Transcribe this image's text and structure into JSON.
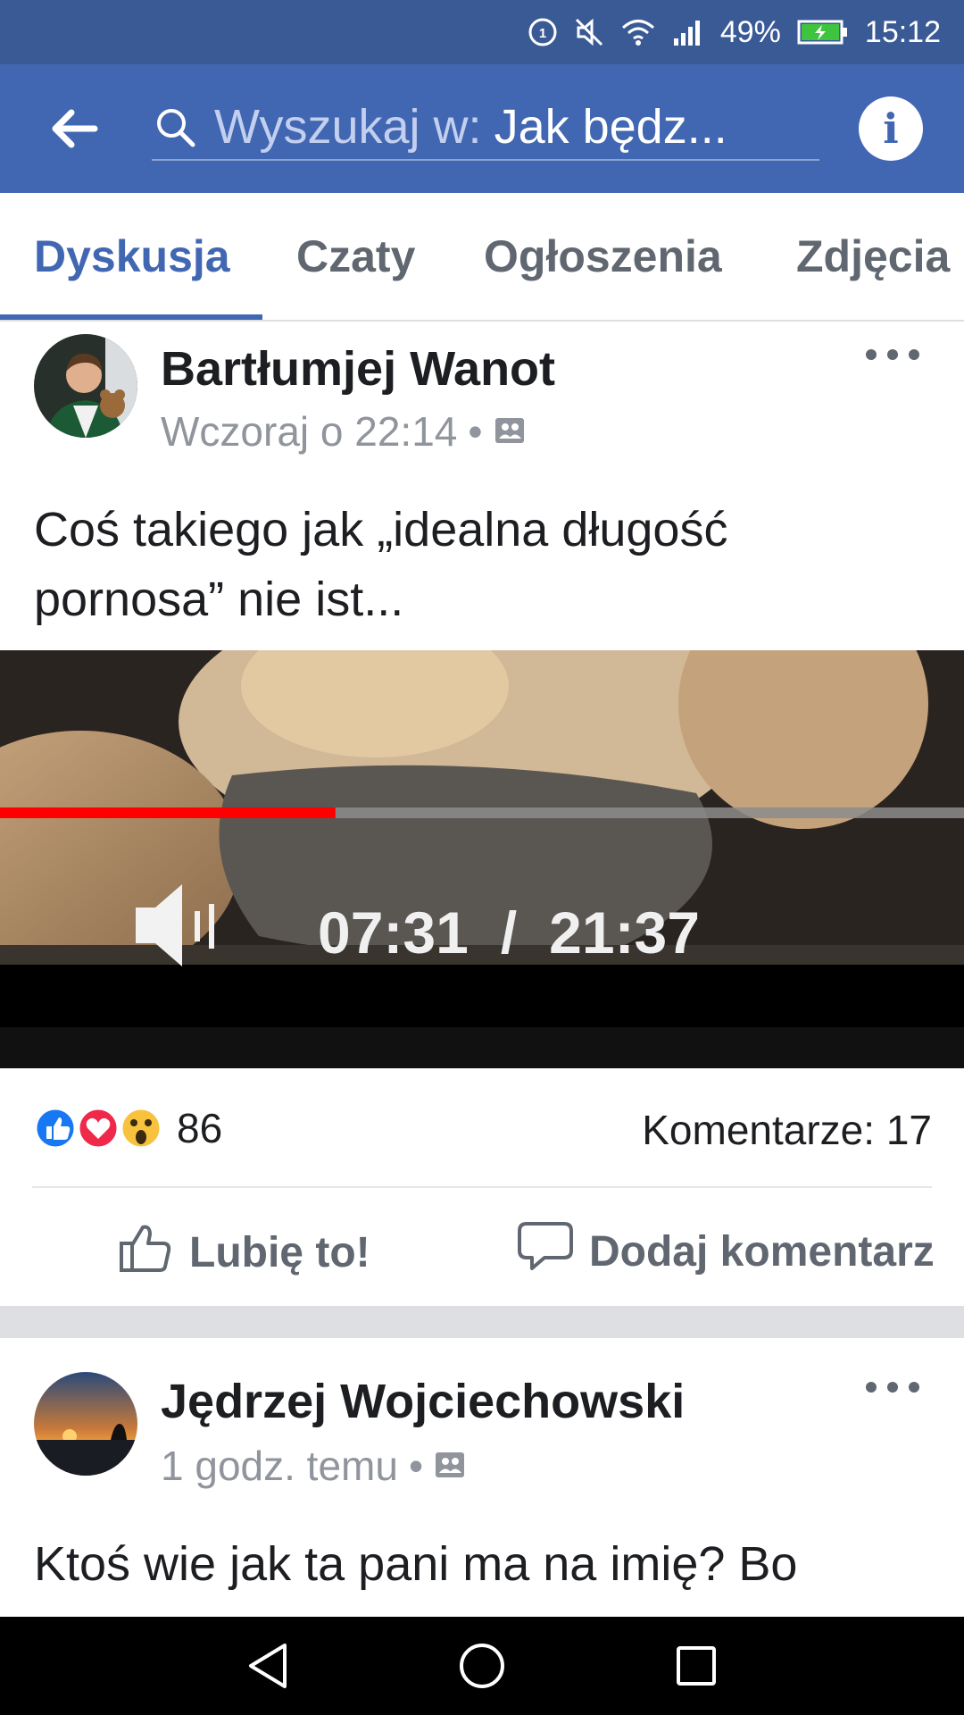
{
  "status_bar": {
    "battery_percent": "49%",
    "time": "15:12",
    "icons": [
      "data-sync-icon",
      "mute-icon",
      "wifi-icon",
      "signal-icon",
      "battery-charging-icon"
    ]
  },
  "app_bar": {
    "back_icon": "back-arrow-icon",
    "search_placeholder": "Wyszukaj w:",
    "search_scope": "Jak będz...",
    "info_icon": "info-icon",
    "info_label": "i"
  },
  "tabs": [
    {
      "label": "Dyskusja",
      "active": true
    },
    {
      "label": "Czaty",
      "active": false
    },
    {
      "label": "Ogłoszenia",
      "active": false
    },
    {
      "label": "Zdjęcia",
      "active": false
    }
  ],
  "posts": [
    {
      "author": "Bartłumjej Wanot",
      "time": "Wczoraj o 22:14",
      "separator": "•",
      "audience_icon": "group-audience-icon",
      "text": "Coś takiego jak „idealna długość pornosa” nie ist...",
      "video": {
        "current_time": "07:31",
        "time_separator": "/",
        "duration": "21:37",
        "progress": 0.348
      },
      "reactions": {
        "icons": [
          "like-reaction-icon",
          "love-reaction-icon",
          "wow-reaction-icon"
        ],
        "count": "86"
      },
      "comments_label": "Komentarze: 17",
      "like_label": "Lubię to!",
      "comment_label": "Dodaj komentarz"
    },
    {
      "author": "Jędrzej Wojciechowski",
      "time": "1 godz. temu",
      "separator": "•",
      "audience_icon": "group-audience-icon",
      "text": "Ktoś wie jak ta pani ma na imię? Bo"
    }
  ],
  "nav_bar": {
    "buttons": [
      "back-nav-icon",
      "home-nav-icon",
      "recents-nav-icon"
    ]
  },
  "colors": {
    "brand_blue": "#4267b2",
    "status_bar": "#3a5a95",
    "video_progress": "#ff0000"
  }
}
